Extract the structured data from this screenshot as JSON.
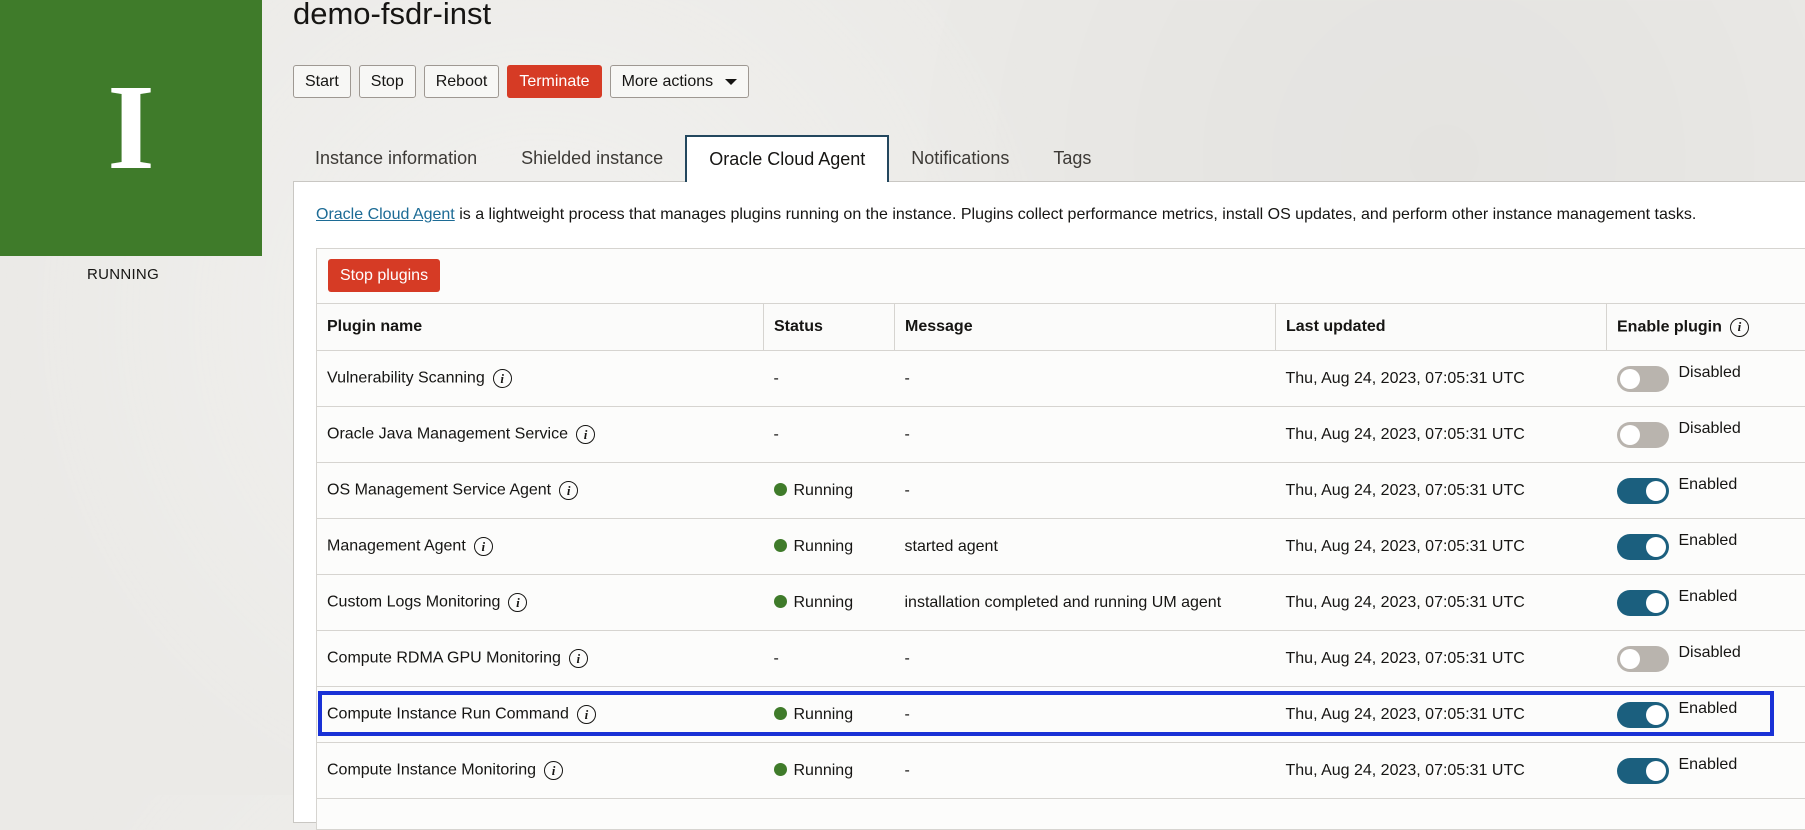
{
  "instance": {
    "letter": "I",
    "state": "RUNNING",
    "tile_color": "#3f7b2a"
  },
  "page_title": "demo-fsdr-inst",
  "toolbar": {
    "start": "Start",
    "stop": "Stop",
    "reboot": "Reboot",
    "terminate": "Terminate",
    "more_actions": "More actions"
  },
  "tabs": [
    {
      "label": "Instance information",
      "active": false
    },
    {
      "label": "Shielded instance",
      "active": false
    },
    {
      "label": "Oracle Cloud Agent",
      "active": true
    },
    {
      "label": "Notifications",
      "active": false
    },
    {
      "label": "Tags",
      "active": false
    }
  ],
  "intro": {
    "link_text": "Oracle Cloud Agent",
    "text": " is a lightweight process that manages plugins running on the instance. Plugins collect performance metrics, install OS updates, and perform other instance management tasks."
  },
  "stop_plugins_label": "Stop plugins",
  "table": {
    "headers": {
      "name": "Plugin name",
      "status": "Status",
      "message": "Message",
      "last_updated": "Last updated",
      "enable": "Enable plugin"
    },
    "rows": [
      {
        "name": "Vulnerability Scanning",
        "status": "-",
        "running": false,
        "message": "-",
        "last_updated": "Thu, Aug 24, 2023, 07:05:31 UTC",
        "enabled": false,
        "toggle_label": "Disabled"
      },
      {
        "name": "Oracle Java Management Service",
        "status": "-",
        "running": false,
        "message": "-",
        "last_updated": "Thu, Aug 24, 2023, 07:05:31 UTC",
        "enabled": false,
        "toggle_label": "Disabled"
      },
      {
        "name": "OS Management Service Agent",
        "status": "Running",
        "running": true,
        "message": "-",
        "last_updated": "Thu, Aug 24, 2023, 07:05:31 UTC",
        "enabled": true,
        "toggle_label": "Enabled"
      },
      {
        "name": "Management Agent",
        "status": "Running",
        "running": true,
        "message": "started agent",
        "last_updated": "Thu, Aug 24, 2023, 07:05:31 UTC",
        "enabled": true,
        "toggle_label": "Enabled"
      },
      {
        "name": "Custom Logs Monitoring",
        "status": "Running",
        "running": true,
        "message": "installation completed and running UM agent",
        "last_updated": "Thu, Aug 24, 2023, 07:05:31 UTC",
        "enabled": true,
        "toggle_label": "Enabled"
      },
      {
        "name": "Compute RDMA GPU Monitoring",
        "status": "-",
        "running": false,
        "message": "-",
        "last_updated": "Thu, Aug 24, 2023, 07:05:31 UTC",
        "enabled": false,
        "toggle_label": "Disabled"
      },
      {
        "name": "Compute Instance Run Command",
        "status": "Running",
        "running": true,
        "message": "-",
        "last_updated": "Thu, Aug 24, 2023, 07:05:31 UTC",
        "enabled": true,
        "toggle_label": "Enabled",
        "highlighted": true
      },
      {
        "name": "Compute Instance Monitoring",
        "status": "Running",
        "running": true,
        "message": "-",
        "last_updated": "Thu, Aug 24, 2023, 07:05:31 UTC",
        "enabled": true,
        "toggle_label": "Enabled"
      }
    ]
  },
  "colors": {
    "danger": "#d63b25",
    "toggle_on": "#1b5f7e",
    "toggle_off": "#b9b4ae",
    "running_dot": "#3f7b2a",
    "highlight": "#1931d6",
    "link": "#1c6b95"
  }
}
